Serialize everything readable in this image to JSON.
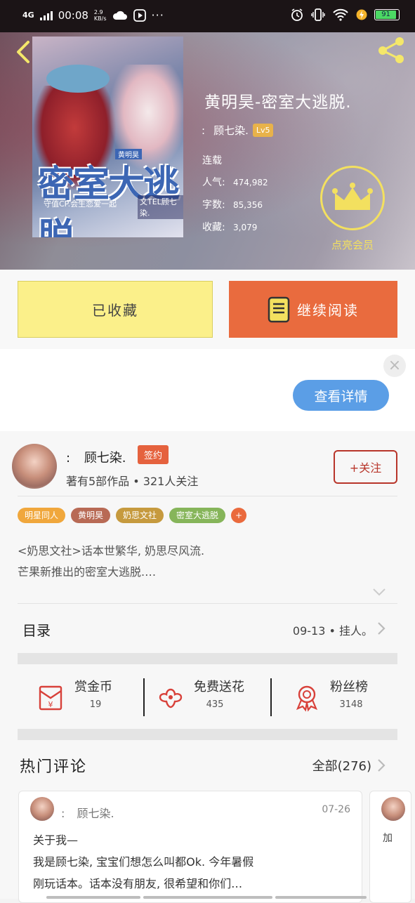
{
  "status": {
    "network": "4G",
    "time": "00:08",
    "speed_top": "2.9",
    "speed_bottom": "KB/s",
    "dots": "···",
    "battery": "91"
  },
  "book": {
    "title": "黄明昊-密室大逃脱.",
    "author_prefix": ":",
    "author": "顾七染.",
    "level": "Lv5",
    "status": "连载",
    "popularity_label": "人气:",
    "popularity": "474,982",
    "words_label": "字数:",
    "words": "85,356",
    "favorites_label": "收藏:",
    "favorites": "3,079",
    "vip_label": "点亮会员",
    "cover": {
      "title_text": "密室大逃脱",
      "small_tag": "黄明昊",
      "tagline": "守值CP.会生恋爱一起",
      "byline": "文TEL顾七染."
    }
  },
  "actions": {
    "favorited_label": "已收藏",
    "continue_label": "继续阅读"
  },
  "ad": {
    "close": "×",
    "details_label": "查看详情"
  },
  "author_section": {
    "prefix": ":",
    "name": "顾七染.",
    "signed_badge": "签约",
    "stats": "著有5部作品 • 321人关注",
    "follow_label": "+关注"
  },
  "tags": [
    {
      "label": "明星同人",
      "color": "#f0a73c"
    },
    {
      "label": "黄明昊",
      "color": "#b86a55"
    },
    {
      "label": "奶思文社",
      "color": "#c69a3e"
    },
    {
      "label": "密室大逃脱",
      "color": "#86b55a"
    },
    {
      "label": "+",
      "color": "#ea6a3d"
    }
  ],
  "description": {
    "line1": "<奶思文社>话本世繁华, 奶思尽风流.",
    "line2": "芒果新推出的密室大逃脱.…"
  },
  "toc": {
    "label": "目录",
    "latest": "09-13 • 挂人。"
  },
  "rewards": [
    {
      "label": "赏金币",
      "value": "19",
      "icon": "red-envelope-icon"
    },
    {
      "label": "免费送花",
      "value": "435",
      "icon": "flower-icon"
    },
    {
      "label": "粉丝榜",
      "value": "3148",
      "icon": "medal-icon"
    }
  ],
  "comments": {
    "title": "热门评论",
    "all_label": "全部(276)",
    "card1": {
      "prefix": ":",
      "name": "顾七染.",
      "date": "07-26",
      "line1": "关于我—",
      "line2": "我是顾七染, 宝宝们想怎么叫都Ok. 今年暑假",
      "line3": "刚玩话本。话本没有朋友, 很希望和你们…"
    },
    "card2": {
      "snippet": "加"
    }
  },
  "colors": {
    "accent_orange": "#e96b3e",
    "fav_yellow": "#fbf08a",
    "vip_yellow": "#f3e05f",
    "follow_red": "#b8352a",
    "ad_blue": "#5b9ee6"
  }
}
